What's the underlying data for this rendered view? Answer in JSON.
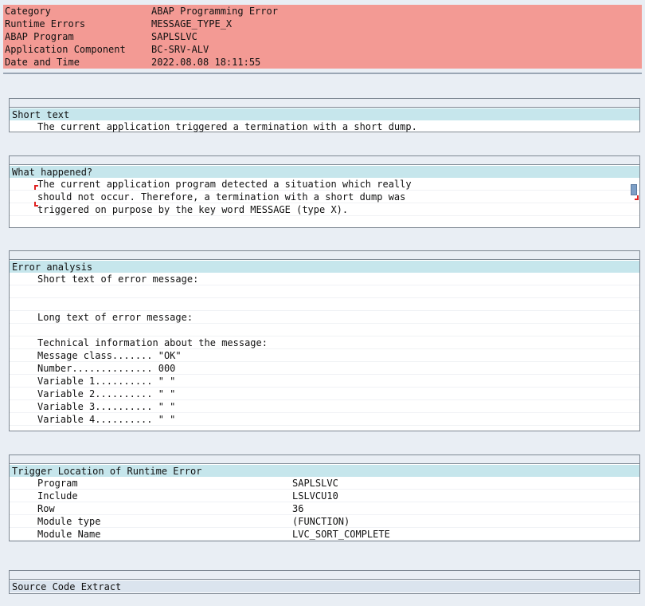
{
  "header": {
    "rows": [
      {
        "key": "Category",
        "value": "ABAP Programming Error"
      },
      {
        "key": "Runtime Errors",
        "value": "MESSAGE_TYPE_X"
      },
      {
        "key": "ABAP Program",
        "value": "SAPLSLVC"
      },
      {
        "key": "Application Component",
        "value": "BC-SRV-ALV"
      },
      {
        "key": "Date and Time",
        "value": "2022.08.08 18:11:55"
      }
    ]
  },
  "short_text": {
    "title": "Short text",
    "lines": [
      "The current application triggered a termination with a short dump."
    ]
  },
  "what_happened": {
    "title": "What happened?",
    "lines": [
      "The current application program detected a situation which really",
      "should not occur. Therefore, a termination with a short dump was",
      "triggered on purpose by the key word MESSAGE (type X)."
    ]
  },
  "error_analysis": {
    "title": "Error analysis",
    "lines": [
      "Short text of error message:",
      "",
      "",
      "Long text of error message:",
      "",
      "Technical information about the message:",
      "Message class....... \"OK\"",
      "Number.............. 000",
      "Variable 1.......... \" \"",
      "Variable 2.......... \" \"",
      "Variable 3.......... \" \"",
      "Variable 4.......... \" \""
    ]
  },
  "trigger_location": {
    "title": "Trigger Location of Runtime Error",
    "rows": [
      {
        "key": "Program",
        "value": "SAPLSLVC"
      },
      {
        "key": "Include",
        "value": "LSLVCU10"
      },
      {
        "key": "Row",
        "value": "36"
      },
      {
        "key": "Module type",
        "value": "(FUNCTION)"
      },
      {
        "key": "Module Name",
        "value": "LVC_SORT_COMPLETE"
      }
    ]
  },
  "source_code": {
    "title": "Source Code Extract"
  },
  "colors": {
    "header_bg": "#f39a94",
    "section_title_bg": "#c6e6ec",
    "page_bg": "#e9eef4"
  }
}
